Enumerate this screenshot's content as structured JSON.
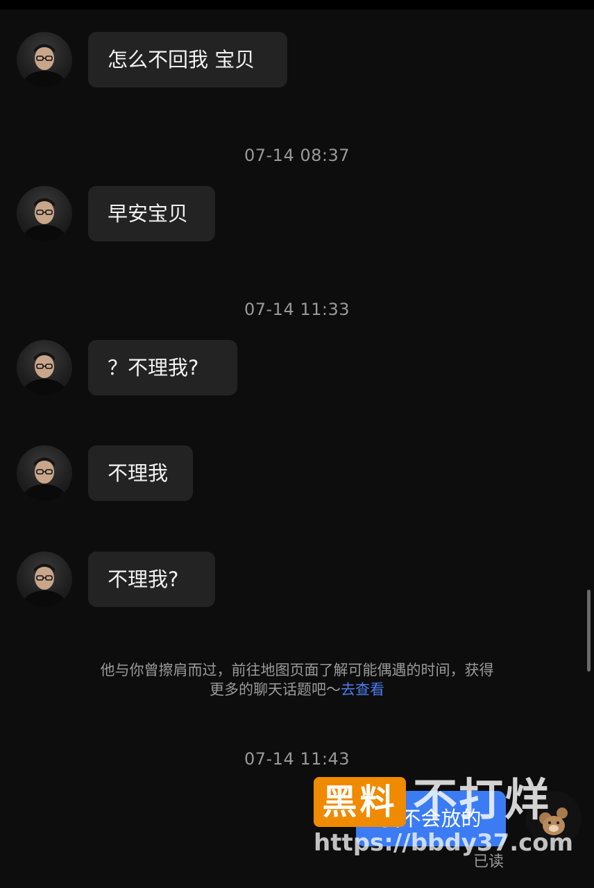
{
  "messages": [
    {
      "text": "怎么不回我 宝贝"
    },
    {
      "text": "早安宝贝"
    },
    {
      "text": "？不理我?"
    },
    {
      "text": "不理我"
    },
    {
      "text": "不理我?"
    }
  ],
  "timestamps": [
    "07-14 08:37",
    "07-14 11:33",
    "07-14 11:43"
  ],
  "system_note": {
    "line1": "他与你曾擦肩而过，前往地图页面了解可能偶遇的时间，获得",
    "line2": "更多的聊天话题吧～",
    "link": "去查看"
  },
  "outgoing": {
    "text": "我不会放的",
    "status": "已读"
  },
  "watermark": {
    "badge": "黑料",
    "title": "不打烊",
    "url": "https://bbdy37.com"
  },
  "icons": {
    "contact_avatar": "person-avatar-icon",
    "self_avatar": "bear-avatar-icon"
  },
  "colors": {
    "background": "#0d0d0d",
    "incoming_bubble": "#232323",
    "outgoing_bubble": "#3b7cf5",
    "link": "#4a7cf0",
    "watermark_orange": "#f08a00"
  }
}
